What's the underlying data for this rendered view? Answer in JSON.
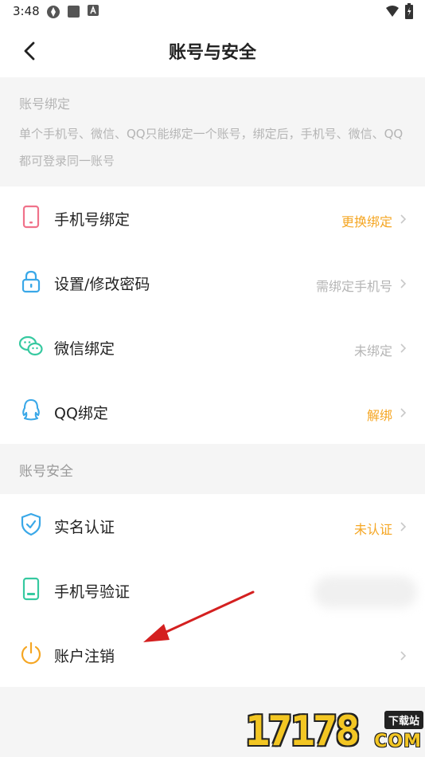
{
  "status_bar": {
    "time": "3:48",
    "icons": [
      "app-icon",
      "square-icon",
      "a-badge-icon"
    ],
    "right_icons": [
      "wifi-icon",
      "battery-icon"
    ]
  },
  "nav": {
    "title": "账号与安全",
    "back_icon": "chevron-left-icon"
  },
  "notice": {
    "title": "账号绑定",
    "description": "单个手机号、微信、QQ只能绑定一个账号，绑定后，手机号、微信、QQ都可登录同一账号"
  },
  "binding_rows": [
    {
      "icon": "phone-icon",
      "label": "手机号绑定",
      "value": "更换绑定",
      "value_color": "#f5a623"
    },
    {
      "icon": "lock-icon",
      "label": "设置/修改密码",
      "value": "需绑定手机号",
      "value_color": "#b5b5b5"
    },
    {
      "icon": "wechat-icon",
      "label": "微信绑定",
      "value": "未绑定",
      "value_color": "#b5b5b5"
    },
    {
      "icon": "qq-icon",
      "label": "QQ绑定",
      "value": "解绑",
      "value_color": "#f5a623"
    }
  ],
  "security_section": {
    "title": "账号安全",
    "rows": [
      {
        "icon": "shield-check-icon",
        "label": "实名认证",
        "value": "未认证",
        "value_color": "#f5a623"
      },
      {
        "icon": "phone-verify-icon",
        "label": "手机号验证",
        "value": ""
      },
      {
        "icon": "power-icon",
        "label": "账户注销",
        "value": ""
      }
    ]
  },
  "watermark": {
    "digits": "17178",
    "badge": "下载站",
    "domain": "COM"
  },
  "colors": {
    "accent_orange": "#f5a623",
    "muted_gray": "#b5b5b5",
    "arrow_red": "#d42020"
  }
}
